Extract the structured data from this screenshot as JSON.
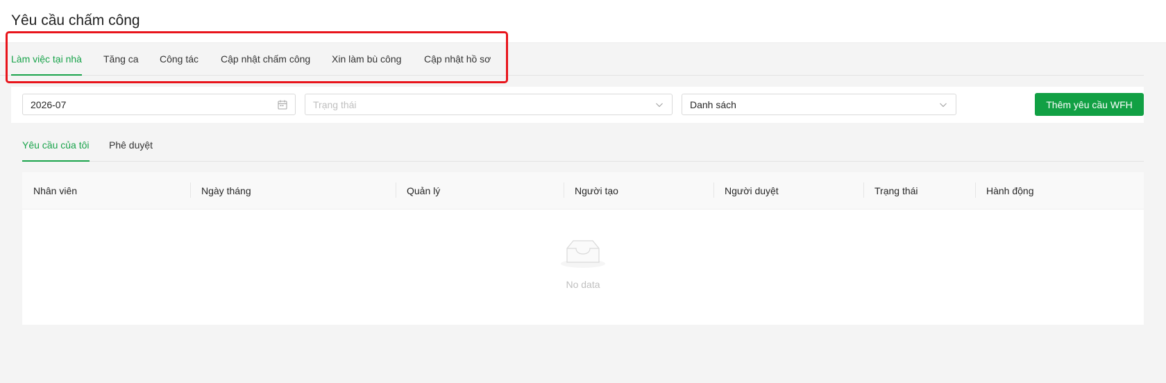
{
  "page": {
    "title": "Yêu cầu chấm công"
  },
  "main_tabs": [
    {
      "label": "Làm việc tại nhà",
      "active": true
    },
    {
      "label": "Tăng ca",
      "active": false
    },
    {
      "label": "Công tác",
      "active": false
    },
    {
      "label": "Cập nhật chấm công",
      "active": false
    },
    {
      "label": "Xin làm bù công",
      "active": false
    },
    {
      "label": "Cập nhật hồ sơ",
      "active": false
    }
  ],
  "filters": {
    "month": {
      "value": "2026-07",
      "icon": "calendar-icon"
    },
    "status": {
      "placeholder": "Trạng thái",
      "icon": "chevron-down-icon"
    },
    "view": {
      "value": "Danh sách",
      "icon": "chevron-down-icon"
    },
    "add_button_label": "Thêm yêu cầu WFH"
  },
  "sub_tabs": [
    {
      "label": "Yêu cầu của tôi",
      "active": true
    },
    {
      "label": "Phê duyệt",
      "active": false
    }
  ],
  "table": {
    "columns": [
      "Nhân viên",
      "Ngày tháng",
      "Quản lý",
      "Người tạo",
      "Người duyệt",
      "Trạng thái",
      "Hành động"
    ],
    "rows": [],
    "empty_text": "No data"
  },
  "colors": {
    "accent": "#18a34a",
    "primary_button": "#11a044",
    "highlight_border": "#e8141b"
  }
}
